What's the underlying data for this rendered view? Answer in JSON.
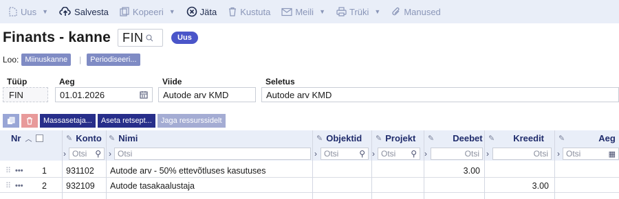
{
  "toolbar": {
    "new_label": "Uus",
    "save_label": "Salvesta",
    "copy_label": "Kopeeri",
    "leave_label": "Jäta",
    "delete_label": "Kustuta",
    "mail_label": "Meili",
    "print_label": "Trüki",
    "attach_label": "Manused"
  },
  "header": {
    "title": "Finants - kanne",
    "code": "FIN",
    "badge": "Uus",
    "create_label": "Loo:",
    "create_buttons": [
      "Miinuskanne",
      "Periodiseeri..."
    ]
  },
  "fields": {
    "type": {
      "label": "Tüüp",
      "value": "FIN"
    },
    "date": {
      "label": "Aeg",
      "value": "01.01.2026"
    },
    "reference": {
      "label": "Viide",
      "value": "Autode arv KMD"
    },
    "description": {
      "label": "Seletus",
      "value": "Autode arv KMD"
    }
  },
  "grid_actions": {
    "mass_set": "Massasetaja...",
    "set_recipe": "Aseta retsept...",
    "share_resources": "Jaga ressurssidelt"
  },
  "table": {
    "columns": {
      "nr": "Nr",
      "account": "Konto",
      "name": "Nimi",
      "objects": "Objektid",
      "project": "Projekt",
      "debit": "Deebet",
      "credit": "Kreedit",
      "time": "Aeg"
    },
    "search_placeholder": "Otsi",
    "rows": [
      {
        "nr": "1",
        "account": "931102",
        "name": "Autode arv - 50% ettevõtluses kasutuses",
        "objects": "",
        "project": "",
        "debit": "3.00",
        "credit": "",
        "time": ""
      },
      {
        "nr": "2",
        "account": "932109",
        "name": "Autode tasakaalustaja",
        "objects": "",
        "project": "",
        "debit": "",
        "credit": "3.00",
        "time": ""
      }
    ]
  },
  "colors": {
    "toolbar_bg": "#e9eef8",
    "badge": "#4a55c9",
    "dark_button": "#272e8a",
    "light_button": "#a4acd3",
    "delete_button": "#e89a9a"
  }
}
